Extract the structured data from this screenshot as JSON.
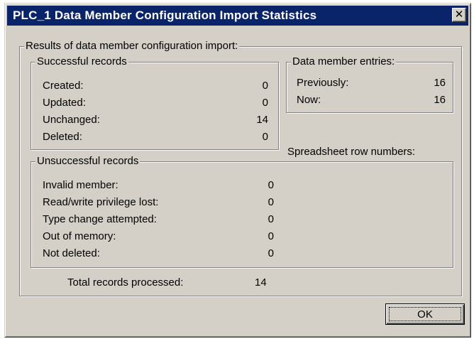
{
  "window": {
    "title": "PLC_1 Data Member Configuration Import Statistics",
    "close_label": "✕"
  },
  "results": {
    "label": "Results of data member configuration import:",
    "successful": {
      "label": "Successful records",
      "rows": [
        {
          "label": "Created:",
          "value": "0"
        },
        {
          "label": "Updated:",
          "value": "0"
        },
        {
          "label": "Unchanged:",
          "value": "14"
        },
        {
          "label": "Deleted:",
          "value": "0"
        }
      ]
    },
    "entries": {
      "label": "Data member entries:",
      "rows": [
        {
          "label": "Previously:",
          "value": "16"
        },
        {
          "label": "Now:",
          "value": "16"
        }
      ]
    },
    "spreadsheet_label": "Spreadsheet row numbers:",
    "unsuccessful": {
      "label": "Unsuccessful records",
      "rows": [
        {
          "label": "Invalid member:",
          "value": "0"
        },
        {
          "label": "Read/write privilege lost:",
          "value": "0"
        },
        {
          "label": "Type change attempted:",
          "value": "0"
        },
        {
          "label": "Out of memory:",
          "value": "0"
        },
        {
          "label": "Not deleted:",
          "value": "0"
        }
      ]
    },
    "total": {
      "label": "Total records processed:",
      "value": "14"
    }
  },
  "buttons": {
    "ok_label": "OK"
  }
}
